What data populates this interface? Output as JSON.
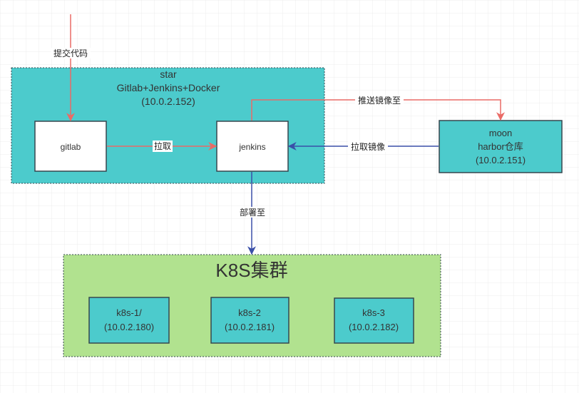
{
  "colors": {
    "teal": "#4ccbcc",
    "green": "#b1e28f",
    "red": "#ea6b66",
    "blue": "#3a4fa8",
    "border": "#36474f"
  },
  "containers": {
    "star": {
      "lines": [
        "star",
        "Gitlab+Jenkins+Docker",
        "(10.0.2.152)"
      ]
    },
    "k8s": {
      "title": "K8S集群"
    }
  },
  "nodes": {
    "gitlab": "gitlab",
    "jenkins": "jenkins",
    "moon": {
      "lines": [
        "moon",
        "harbor仓库",
        "(10.0.2.151)"
      ]
    },
    "k8s1": {
      "lines": [
        "k8s-1/",
        "(10.0.2.180)"
      ]
    },
    "k8s2": {
      "lines": [
        "k8s-2",
        "(10.0.2.181)"
      ]
    },
    "k8s3": {
      "lines": [
        "k8s-3",
        "(10.0.2.182)"
      ]
    }
  },
  "edges": {
    "commit": "提交代码",
    "pull": "拉取",
    "push_image": "推送镜像至",
    "pull_image": "拉取镜像",
    "deploy": "部署至"
  }
}
